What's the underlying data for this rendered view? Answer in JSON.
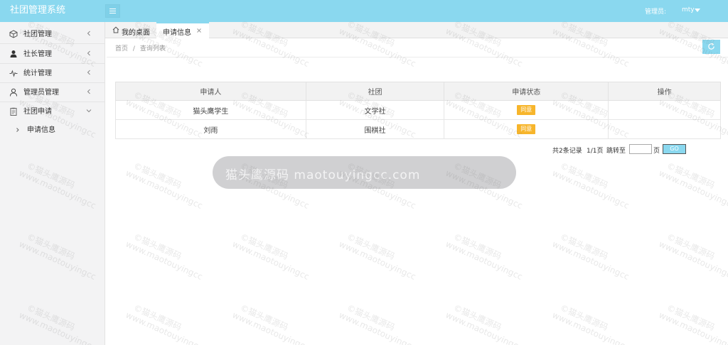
{
  "header": {
    "app_title": "社团管理系统",
    "admin_label": "管理员:",
    "admin_name": "mty"
  },
  "sidebar": {
    "items": [
      {
        "label": "社团管理",
        "icon": "cube-icon"
      },
      {
        "label": "社长管理",
        "icon": "user-solid-icon"
      },
      {
        "label": "统计管理",
        "icon": "pulse-icon"
      },
      {
        "label": "管理员管理",
        "icon": "user-outline-icon"
      },
      {
        "label": "社团申请",
        "icon": "clipboard-icon"
      }
    ],
    "sub_items": [
      {
        "label": "申请信息"
      }
    ]
  },
  "tabs": {
    "home": "我的桌面",
    "active": "申请信息"
  },
  "breadcrumb": {
    "home": "首页",
    "separator": "/",
    "current": "查询列表"
  },
  "table": {
    "headers": [
      "申请人",
      "社团",
      "申请状态",
      "操作"
    ],
    "rows": [
      {
        "applicant": "猫头鹰学生",
        "club": "文学社",
        "status": "同意",
        "action": ""
      },
      {
        "applicant": "刘雨",
        "club": "围棋社",
        "status": "同意",
        "action": ""
      }
    ]
  },
  "pagination": {
    "total": "共2条记录",
    "pages": "1/1页",
    "jump_label": "跳转至",
    "jump_value": "",
    "unit": "页",
    "go": "GO"
  },
  "watermark": {
    "banner": "猫头鹰源码 maotouyingcc.com",
    "line1": "©猫头鹰源码",
    "line2": "www.maotouyingcc.com"
  },
  "colors": {
    "accent": "#8ad8ef",
    "badge": "#f7b52b",
    "sidebar_bg": "#f3f3f4"
  }
}
